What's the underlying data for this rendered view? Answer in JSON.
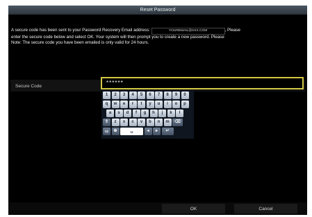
{
  "dialog": {
    "title": "Reset Password",
    "message_part1": "A secure code has been sent to your Password Recovery Email address:",
    "email": "YOUREMAIL@XXX.COM",
    "message_part2": ", Please",
    "message_line2": "enter the secure code below and select OK. Your system will then prompt you to create a new password. Please",
    "message_line3": "Note: The secure code you have been emailed is only valid for 24 hours."
  },
  "form": {
    "secure_code_label": "Secure Code",
    "secure_code_value": "******"
  },
  "keyboard": {
    "row1": [
      "1",
      "2",
      "3",
      "4",
      "5",
      "6",
      "7",
      "8",
      "9",
      "0"
    ],
    "row2": [
      "q",
      "w",
      "e",
      "r",
      "t",
      "y",
      "u",
      "i",
      "o",
      "p"
    ],
    "row3": [
      "a",
      "s",
      "d",
      "f",
      "g",
      "h",
      "j",
      "k",
      "l"
    ],
    "row4": [
      "z",
      "x",
      "c",
      "v",
      "b",
      "n",
      "m"
    ],
    "shift_glyph": "⇧",
    "backspace_glyph": "⌫",
    "symbols_glyph": "!@",
    "globe_glyph": "⊕",
    "space_glyph": "␣",
    "left_glyph": "◂",
    "right_glyph": "▸",
    "enter_glyph": "↵"
  },
  "buttons": {
    "ok": "OK",
    "cancel": "Cancel"
  },
  "colors": {
    "accent_border": "#d4c843",
    "background": "#000000",
    "title_bar": "#3a4550"
  }
}
